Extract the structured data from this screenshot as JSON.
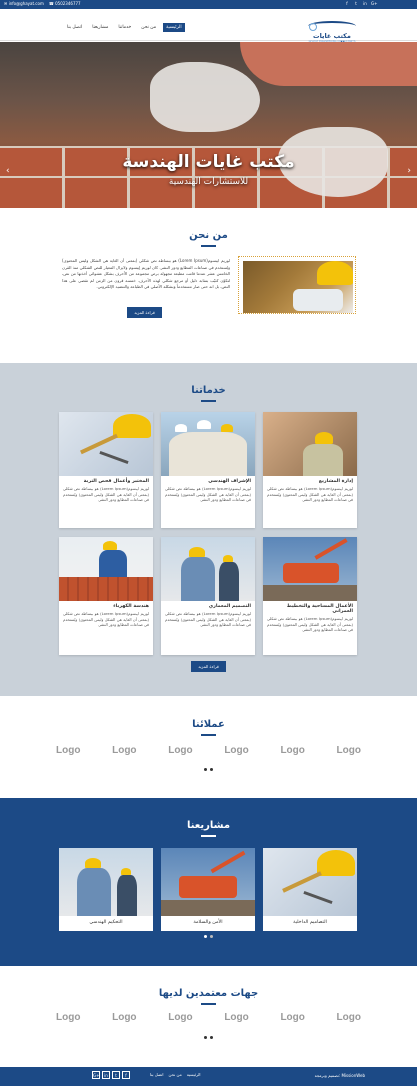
{
  "topbar": {
    "email": "info@ghayat.com",
    "phone": "0502346777",
    "social": [
      "f",
      "t",
      "in",
      "G+"
    ]
  },
  "header": {
    "logo_title": "مكتب غايات الهندسة",
    "logo_subtitle": "GHAYAT ENGINEERING CONSULTANTS",
    "nav": [
      "الرئيسية",
      "من نحن",
      "خدماتنا",
      "مشاريعنا",
      "اتصل بنا"
    ]
  },
  "hero": {
    "title": "مكتب غايات الهندسة",
    "subtitle": "للاستشارات الهندسية",
    "prev": "‹",
    "next": "›"
  },
  "about": {
    "title": "من نحن",
    "text": "لوريم ايبسوم(Lorem Ipsum) هو ببساطة نص شكلي (بمعنى أن الغاية هي الشكل وليس المحتوى) ويُستخدم في صناعات المطابع ودور النشر. كان لوريم إيبسوم ولايزال المعيار للنص الشكلي منذ القرن الخامس عشر عندما قامت مطبعة مجهولة برص مجموعة من الأحرف بشكل عشوائي أخذتها من نص، لتكوّن كتيّب بمثابة دليل أو مرجع شكلي لهذه الأحرف. خمسة قرون من الزمن لم تقضي على هذا النص، بل انه حتى صار مستخدماً وبشكله الأصلي في الطباعة والتنضيد الإلكتروني.",
    "button": "قراءة المزيد"
  },
  "services": {
    "title": "خدماتنا",
    "items": [
      {
        "title": "إدارة المشاريع",
        "desc": "لوريم ايبسوم(Lorem Ipsum) هو ببساطة نص شكلي (بمعنى أن الغاية هي الشكل وليس المحتوى) ويُستخدم في صناعات المطابع ودور النشر."
      },
      {
        "title": "الإشراف الهندسي",
        "desc": "لوريم ايبسوم(Lorem Ipsum) هو ببساطة نص شكلي (بمعنى أن الغاية هي الشكل وليس المحتوى) ويُستخدم في صناعات المطابع ودور النشر."
      },
      {
        "title": "المختبر وأعمال فحص التربة",
        "desc": "لوريم ايبسوم(Lorem Ipsum) هو ببساطة نص شكلي (بمعنى أن الغاية هي الشكل وليس المحتوى) ويُستخدم في صناعات المطابع ودور النشر."
      },
      {
        "title": "الأعمال المساحية والتخطيط العمراني",
        "desc": "لوريم ايبسوم(Lorem Ipsum) هو ببساطة نص شكلي (بمعنى أن الغاية هي الشكل وليس المحتوى) ويُستخدم في صناعات المطابع ودور النشر."
      },
      {
        "title": "التصميم المعماري",
        "desc": "لوريم ايبسوم(Lorem Ipsum) هو ببساطة نص شكلي (بمعنى أن الغاية هي الشكل وليس المحتوى) ويُستخدم في صناعات المطابع ودور النشر."
      },
      {
        "title": "هندسة الكهرباء",
        "desc": "لوريم ايبسوم(Lorem Ipsum) هو ببساطة نص شكلي (بمعنى أن الغاية هي الشكل وليس المحتوى) ويُستخدم في صناعات المطابع ودور النشر."
      }
    ],
    "button": "قراءة المزيد"
  },
  "clients": {
    "title": "عملائنا",
    "logos": [
      "Logo",
      "Logo",
      "Logo",
      "Logo",
      "Logo",
      "Logo"
    ]
  },
  "projects": {
    "title": "مشاريعنا",
    "items": [
      "التحكيم الهندسي",
      "الأمن والسلامة",
      "التصاميم الداخلية"
    ]
  },
  "partners": {
    "title": "جهات معتمدين لديها",
    "logos": [
      "Logo",
      "Logo",
      "Logo",
      "Logo",
      "Logo",
      "Logo"
    ]
  },
  "footer": {
    "links": [
      "الرئيسية",
      "من نحن",
      "اتصل بنا"
    ],
    "social": [
      "G+",
      "in",
      "t",
      "f"
    ],
    "copyright": "تصميم وبرمجة: MissionWeb"
  },
  "colors": {
    "primary": "#1c4a86",
    "services_bg": "#c9d1d9",
    "accent_yellow": "#f3c20a"
  }
}
